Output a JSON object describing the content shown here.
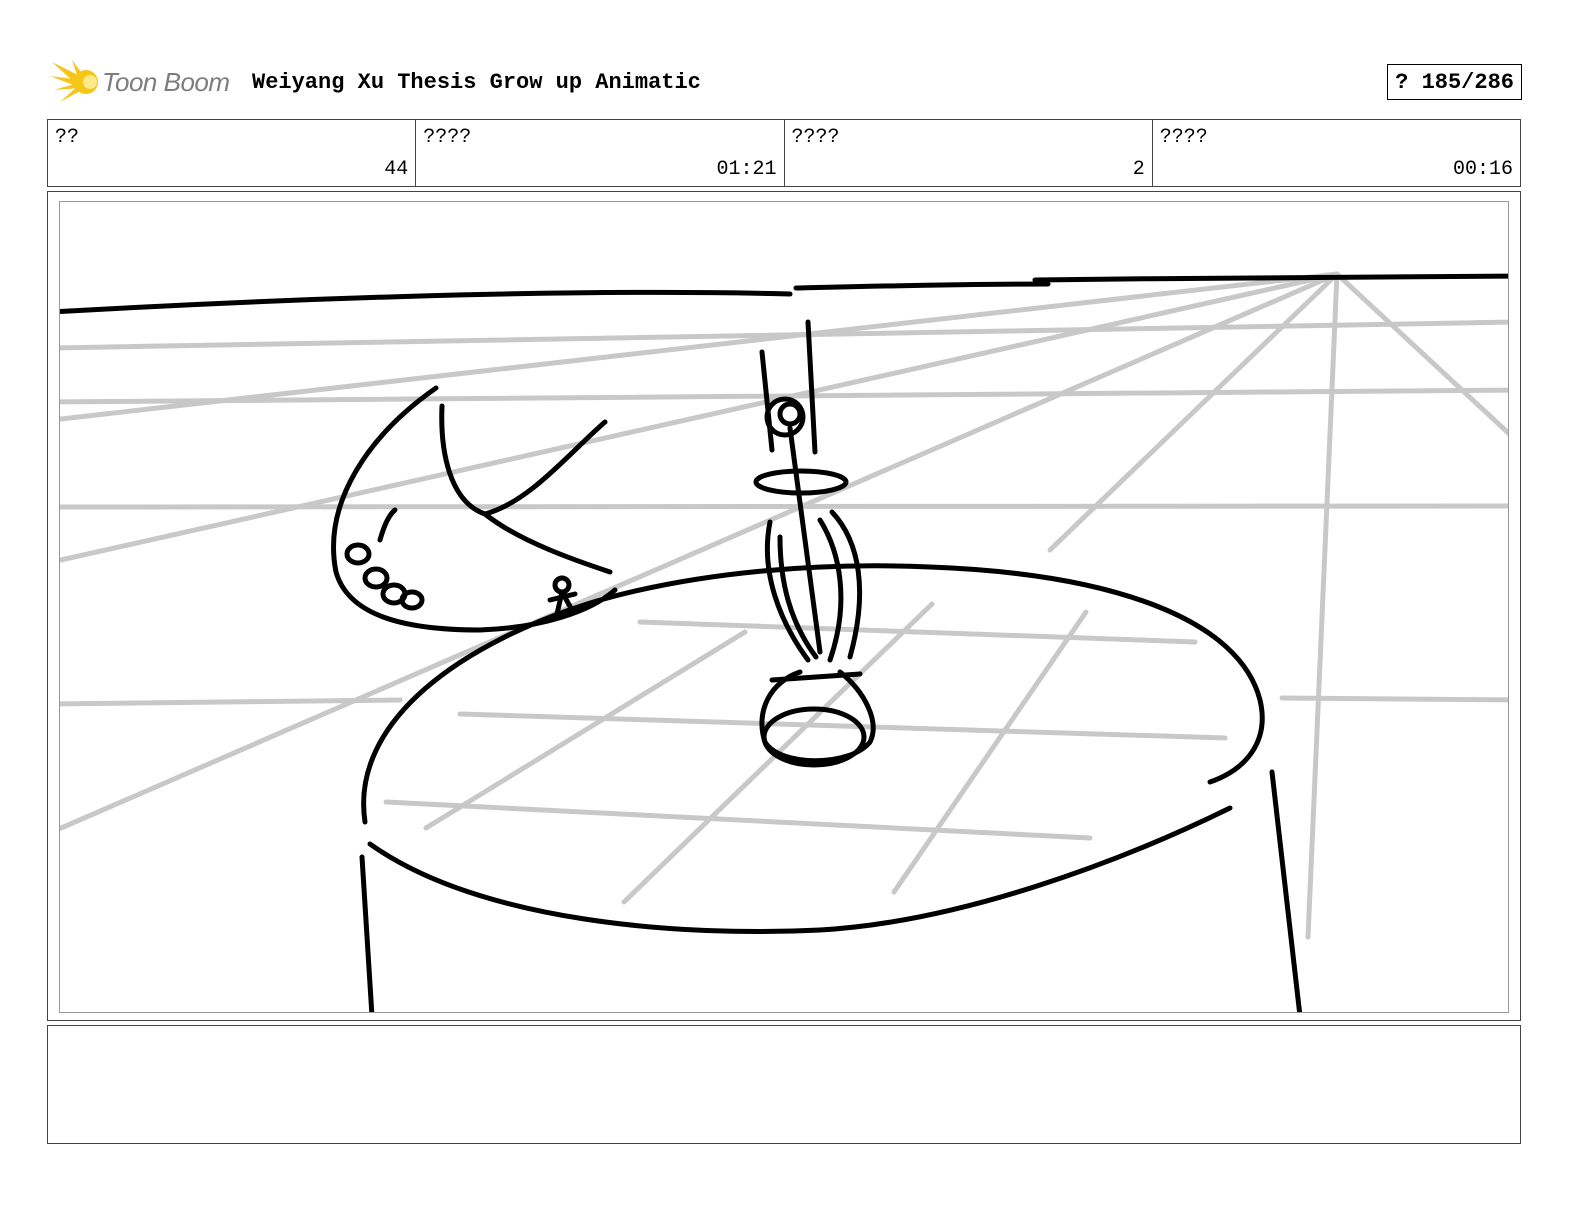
{
  "header": {
    "logo_text": "Toon Boom",
    "title": "Weiyang Xu Thesis Grow up Animatic",
    "page_counter": "? 185/286"
  },
  "info": [
    {
      "label": "??",
      "value": "44"
    },
    {
      "label": "????",
      "value": "01:21"
    },
    {
      "label": "????",
      "value": "2"
    },
    {
      "label": "????",
      "value": "00:16"
    }
  ],
  "colors": {
    "logo_star": "#f5c518",
    "logo_text": "#7d7d7d",
    "guide_lines": "#c8c8c8",
    "ink": "#000000"
  },
  "notes": {
    "text": ""
  }
}
